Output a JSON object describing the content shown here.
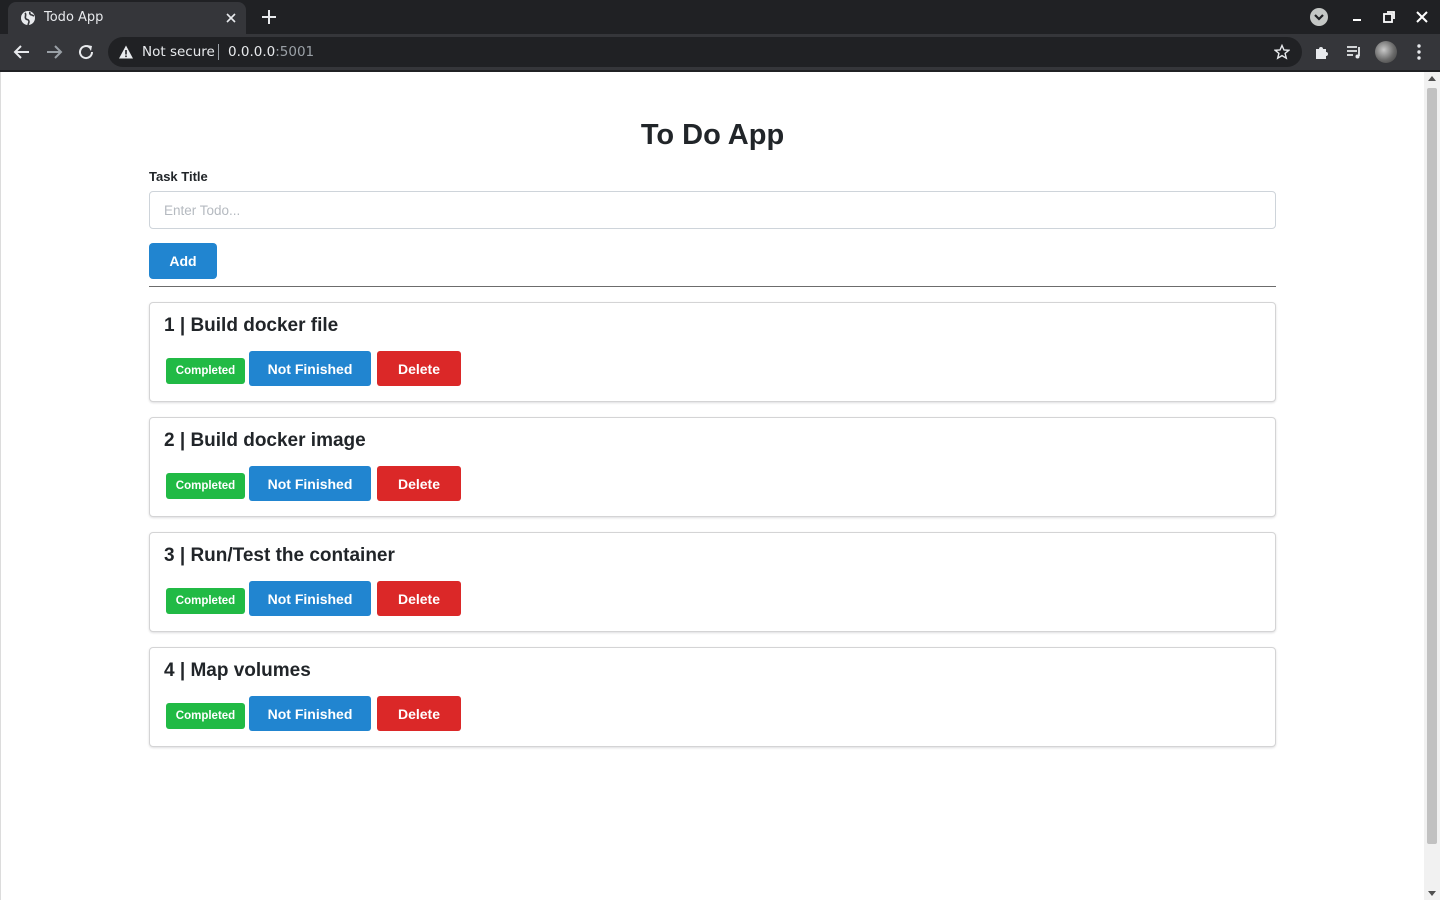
{
  "browser": {
    "tab_title": "Todo App",
    "security_label": "Not secure",
    "url_host": "0.0.0.0",
    "url_port": ":5001",
    "icons": {
      "favicon": "globe-icon",
      "tab_close": "close-icon",
      "new_tab": "plus-icon",
      "tab_search": "tab-search-icon",
      "back": "arrow-left-icon",
      "forward": "arrow-right-icon",
      "reload": "reload-icon",
      "warning": "warning-icon",
      "bookmark": "star-icon",
      "extensions": "puzzle-icon",
      "media": "media-queue-icon",
      "menu": "kebab-menu-icon"
    }
  },
  "app": {
    "title": "To Do App",
    "form": {
      "label": "Task Title",
      "placeholder": "Enter Todo...",
      "value": "",
      "add_label": "Add"
    },
    "tasks": [
      {
        "heading": "1 | Build docker file",
        "status": "Completed",
        "toggle_label": "Not Finished",
        "delete_label": "Delete"
      },
      {
        "heading": "2 | Build docker image",
        "status": "Completed",
        "toggle_label": "Not Finished",
        "delete_label": "Delete"
      },
      {
        "heading": "3 | Run/Test the container",
        "status": "Completed",
        "toggle_label": "Not Finished",
        "delete_label": "Delete"
      },
      {
        "heading": "4 | Map volumes",
        "status": "Completed",
        "toggle_label": "Not Finished",
        "delete_label": "Delete"
      }
    ]
  },
  "colors": {
    "primary": "#2185d0",
    "success": "#21ba45",
    "danger": "#db2828",
    "chrome_dark": "#202124",
    "chrome_toolbar": "#35363a"
  }
}
